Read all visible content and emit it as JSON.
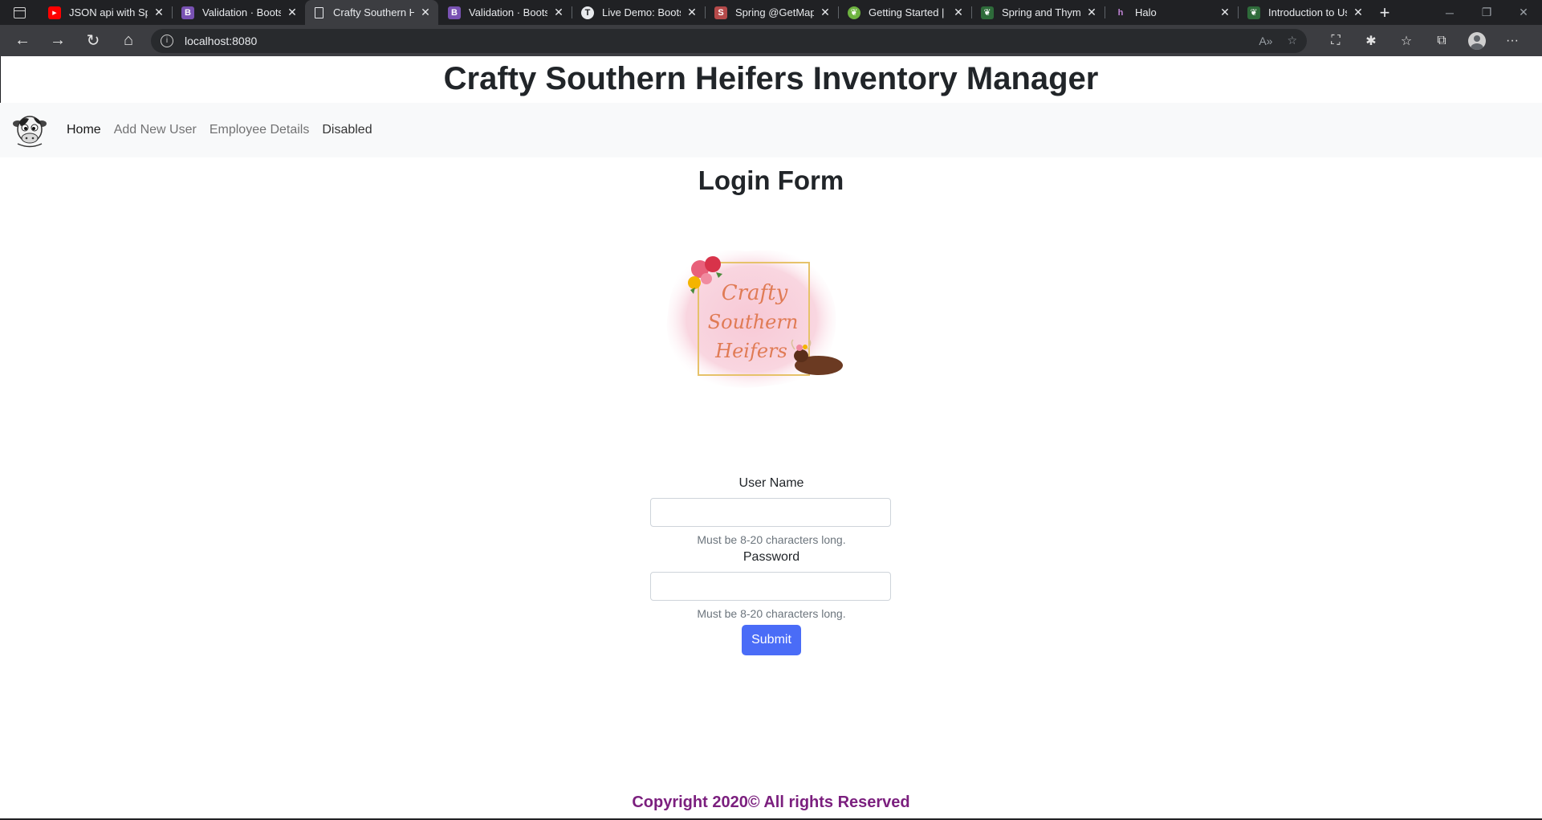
{
  "browser": {
    "tabs": [
      {
        "title": "JSON api with Spri",
        "favicon": "youtube-icon",
        "color": "#ff0000",
        "glyph": "▶"
      },
      {
        "title": "Validation · Bootstr",
        "favicon": "bootstrap-icon",
        "color": "#7952b3",
        "glyph": "B"
      },
      {
        "title": "Crafty Southern He",
        "favicon": "page-icon",
        "color": "#3c3d41",
        "glyph": "",
        "active": true
      },
      {
        "title": "Validation · Bootstr",
        "favicon": "bootstrap-icon",
        "color": "#7952b3",
        "glyph": "B"
      },
      {
        "title": "Live Demo: Bootstr",
        "favicon": "tutorial-icon",
        "color": "#e8eaed",
        "glyph": "T"
      },
      {
        "title": "Spring @GetMappi",
        "favicon": "spring-icon",
        "color": "#b54a4a",
        "glyph": "S"
      },
      {
        "title": "Getting Started | H",
        "favicon": "spring-leaf-icon",
        "color": "#6db33f",
        "glyph": "❦"
      },
      {
        "title": "Spring and Thymel",
        "favicon": "thymeleaf-icon",
        "color": "#005f0f",
        "glyph": "❦"
      },
      {
        "title": "Halo",
        "favicon": "halo-icon",
        "color": "#9b59b6",
        "glyph": "h"
      },
      {
        "title": "Introduction to Usi",
        "favicon": "thymeleaf-icon",
        "color": "#005f0f",
        "glyph": "❦"
      }
    ],
    "url": "localhost:8080"
  },
  "header": {
    "title": "Crafty Southern Heifers Inventory Manager"
  },
  "nav": {
    "links": [
      {
        "label": "Home",
        "state": "active"
      },
      {
        "label": "Add New User",
        "state": "normal"
      },
      {
        "label": "Employee Details",
        "state": "normal"
      },
      {
        "label": "Disabled",
        "state": "disabled"
      }
    ]
  },
  "main": {
    "title": "Login Form",
    "logo_text": [
      "Crafty",
      "Southern",
      "Heifers"
    ]
  },
  "form": {
    "username_label": "User Name",
    "username_value": "",
    "username_help": "Must be 8-20 characters long.",
    "password_label": "Password",
    "password_value": "",
    "password_help": "Must be 8-20 characters long.",
    "submit_label": "Submit"
  },
  "footer": {
    "text": "Copyright 2020© All rights Reserved"
  },
  "colors": {
    "submit": "#4a6cf7",
    "footer": "#7b1f7e"
  }
}
